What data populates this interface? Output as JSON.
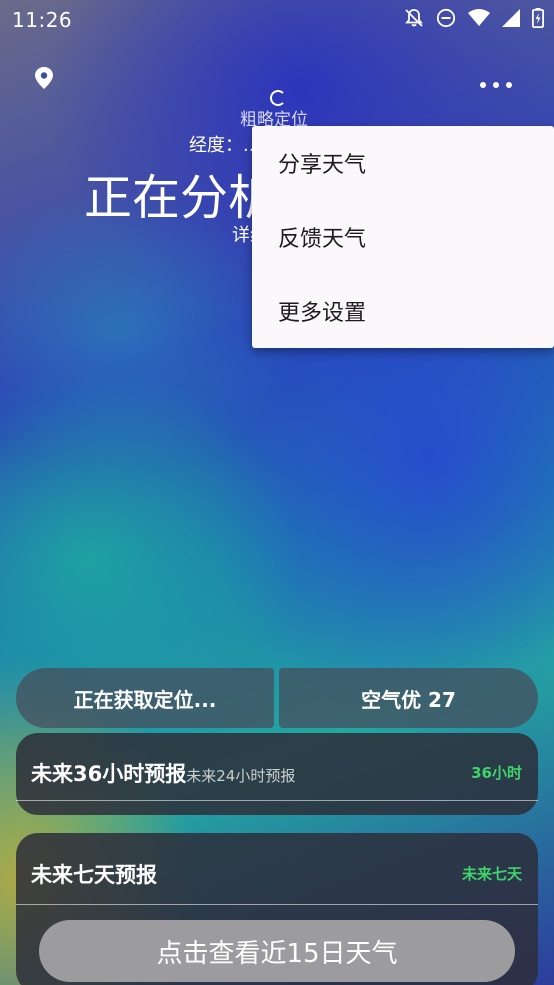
{
  "status_bar": {
    "time": "11:26",
    "icons": [
      "notifications-off-icon",
      "do-not-disturb-icon",
      "wifi-icon",
      "signal-icon",
      "battery-icon"
    ]
  },
  "header": {
    "location_icon": "location-pin-icon",
    "menu_icon": "more-horizontal-icon",
    "coarse_location_label": "粗略定位",
    "longitude_text": "经度：..",
    "status_title": "正在分析",
    "detail_text": "详约"
  },
  "menu": {
    "items": [
      {
        "label": "分享天气"
      },
      {
        "label": "反馈天气"
      },
      {
        "label": "更多设置"
      }
    ]
  },
  "quick_info": {
    "location_status": "正在获取定位...",
    "air_quality": "空气优 27"
  },
  "forecast_36h": {
    "title": "未来36小时预报",
    "subtitle": "未来24小时预报",
    "tag": "36小时"
  },
  "forecast_7d": {
    "title": "未来七天预报",
    "tag": "未来七天",
    "button_label": "点击查看近15日天气"
  },
  "colors": {
    "accent_green": "#3ed46a",
    "menu_bg": "#fbf8fb",
    "card_bg": "#2d2e3a"
  }
}
